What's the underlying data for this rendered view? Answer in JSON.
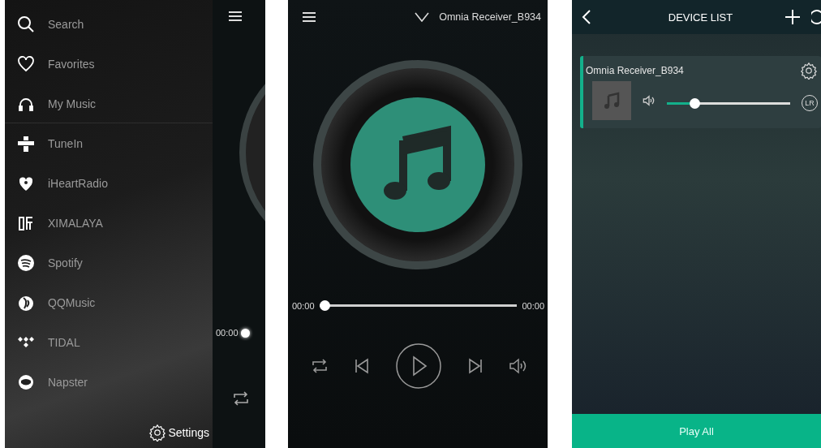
{
  "drawer_screen": {
    "menu_sections": [
      {
        "items": [
          {
            "label": "Search",
            "kind": "search"
          },
          {
            "label": "Favorites",
            "kind": "heart"
          },
          {
            "label": "My Music",
            "kind": "headphones"
          }
        ]
      },
      {
        "items": [
          {
            "label": "TuneIn",
            "kind": "tunein"
          },
          {
            "label": "iHeartRadio",
            "kind": "iheart"
          },
          {
            "label": "XIMALAYA",
            "kind": "ximalaya"
          },
          {
            "label": "Spotify",
            "kind": "spotify"
          },
          {
            "label": "QQMusic",
            "kind": "qq"
          },
          {
            "label": "TIDAL",
            "kind": "tidal"
          },
          {
            "label": "Napster",
            "kind": "napster"
          }
        ]
      }
    ],
    "settings": "Settings",
    "player_behind": {
      "elapsed": "00:00"
    }
  },
  "player_screen": {
    "device_name": "Omnia Receiver_B934",
    "elapsed": "00:00",
    "total": "00:00",
    "progress": {
      "level": 0
    }
  },
  "device_list_screen": {
    "title": "DEVICE LIST",
    "devices": [
      {
        "name": "Omnia Receiver_B934",
        "volume": {
          "level": 0.2
        },
        "channel": "LR"
      }
    ],
    "play_all": "Play All"
  }
}
